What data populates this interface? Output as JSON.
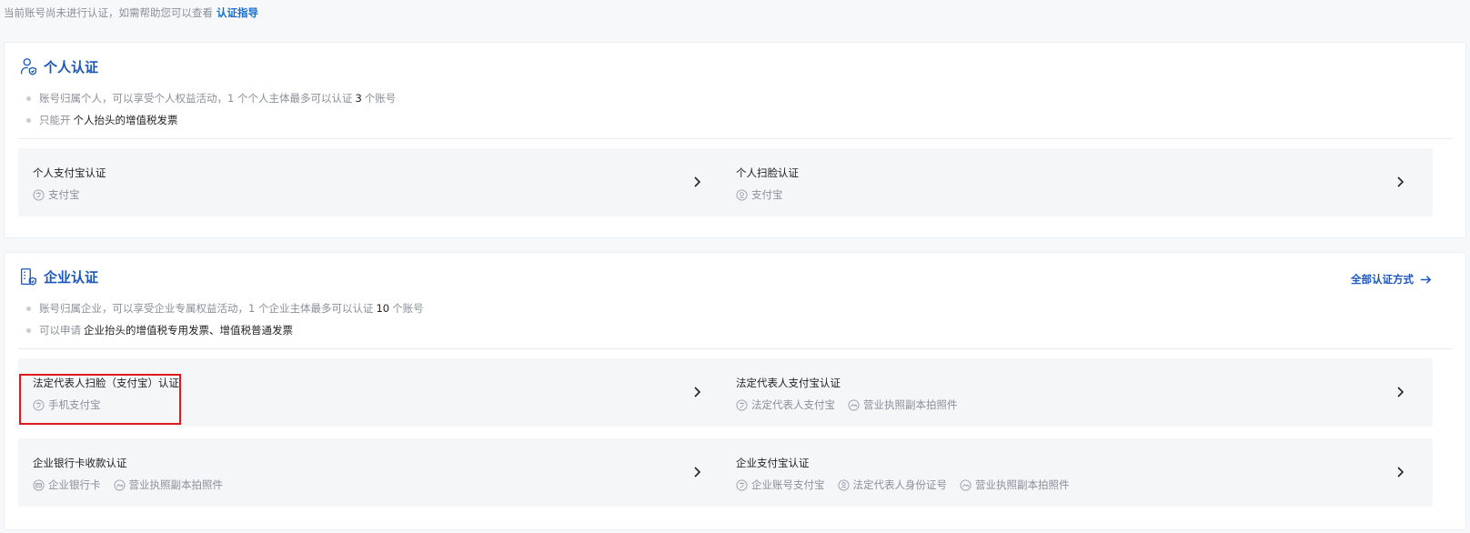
{
  "notice": {
    "text": "当前账号尚未进行认证，如需帮助您可以查看",
    "link": "认证指导"
  },
  "personal": {
    "title": "个人认证",
    "bullet1": {
      "pre": "账号归属个人，可以享受个人权益活动，1 个个人主体最多可以认证",
      "num": "3",
      "post": "个账号"
    },
    "bullet2": {
      "pre": "只能开",
      "strong": "个人抬头的增值税发票"
    },
    "cards": [
      {
        "title": "个人支付宝认证",
        "tags": [
          {
            "icon": "alipay-icon",
            "label": "支付宝"
          }
        ]
      },
      {
        "title": "个人扫脸认证",
        "tags": [
          {
            "icon": "face-icon",
            "label": "支付宝"
          }
        ]
      }
    ]
  },
  "enterprise": {
    "title": "企业认证",
    "all_methods": "全部认证方式",
    "bullet1": {
      "pre": "账号归属企业，可以享受企业专属权益活动，1 个企业主体最多可以认证",
      "num": "10",
      "post": "个账号"
    },
    "bullet2": {
      "pre": "可以申请",
      "strong": "企业抬头的增值税专用发票、增值税普通发票"
    },
    "cards": [
      {
        "title": "法定代表人扫脸（支付宝）认证",
        "tags": [
          {
            "icon": "alipay-icon",
            "label": "手机支付宝"
          }
        ]
      },
      {
        "title": "法定代表人支付宝认证",
        "tags": [
          {
            "icon": "alipay-icon",
            "label": "法定代表人支付宝"
          },
          {
            "icon": "license-icon",
            "label": "营业执照副本拍照件"
          }
        ]
      },
      {
        "title": "企业银行卡收款认证",
        "tags": [
          {
            "icon": "bank-card-icon",
            "label": "企业银行卡"
          },
          {
            "icon": "license-icon",
            "label": "营业执照副本拍照件"
          }
        ]
      },
      {
        "title": "企业支付宝认证",
        "tags": [
          {
            "icon": "alipay-icon",
            "label": "企业账号支付宝"
          },
          {
            "icon": "id-person-icon",
            "label": "法定代表人身份证号"
          },
          {
            "icon": "license-icon",
            "label": "营业执照副本拍照件"
          }
        ]
      }
    ]
  }
}
